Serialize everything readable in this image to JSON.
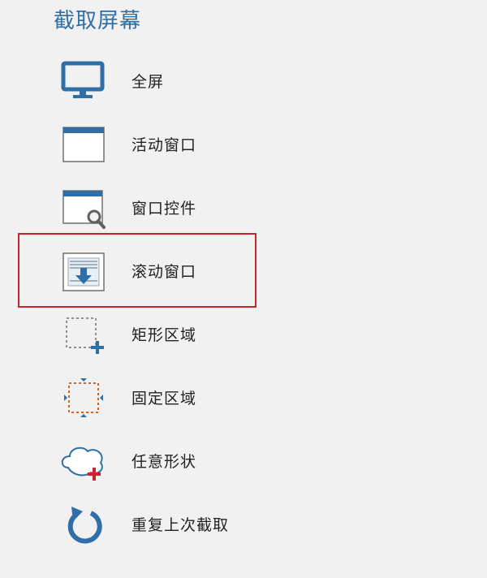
{
  "panel": {
    "title": "截取屏幕",
    "highlight_color": "#d0202a",
    "accent_color": "#2f6fa8",
    "items": [
      {
        "label": "全屏",
        "icon": "monitor-icon"
      },
      {
        "label": "活动窗口",
        "icon": "active-window-icon"
      },
      {
        "label": "窗口控件",
        "icon": "window-control-icon"
      },
      {
        "label": "滚动窗口",
        "icon": "scroll-window-icon",
        "highlighted": true
      },
      {
        "label": "矩形区域",
        "icon": "rectangle-region-icon"
      },
      {
        "label": "固定区域",
        "icon": "fixed-region-icon"
      },
      {
        "label": "任意形状",
        "icon": "freeform-shape-icon"
      },
      {
        "label": "重复上次截取",
        "icon": "repeat-last-capture-icon"
      }
    ]
  }
}
